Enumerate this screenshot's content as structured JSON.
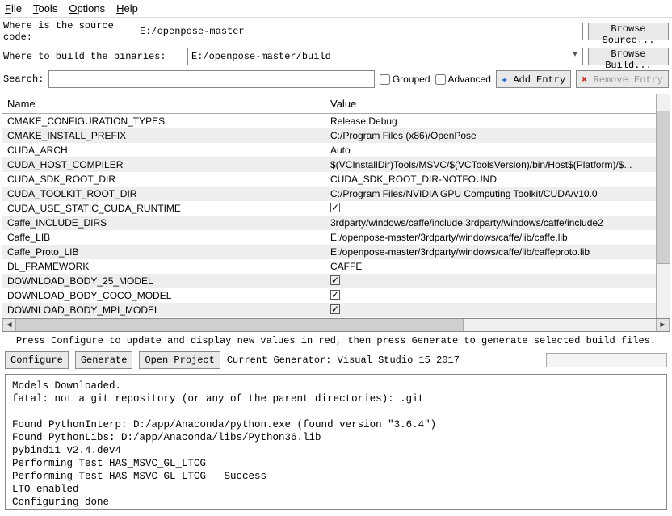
{
  "menu": {
    "file": "File",
    "tools": "Tools",
    "options": "Options",
    "help": "Help"
  },
  "labels": {
    "source": "Where is the source code:",
    "build": "Where to build the binaries:",
    "search": "Search:"
  },
  "paths": {
    "source": "E:/openpose-master",
    "build": "E:/openpose-master/build",
    "search": ""
  },
  "buttons": {
    "browse_source": "Browse Source...",
    "browse_build": "Browse Build...",
    "grouped": "Grouped",
    "advanced": "Advanced",
    "add_entry": "Add Entry",
    "remove_entry": "Remove Entry",
    "configure": "Configure",
    "generate": "Generate",
    "open_project": "Open Project"
  },
  "checks": {
    "grouped": false,
    "advanced": false
  },
  "table": {
    "headers": {
      "name": "Name",
      "value": "Value"
    },
    "rows": [
      {
        "name": "CMAKE_CONFIGURATION_TYPES",
        "value": "Release;Debug",
        "hl": false,
        "type": "text"
      },
      {
        "name": "CMAKE_INSTALL_PREFIX",
        "value": "C:/Program Files (x86)/OpenPose",
        "hl": true,
        "type": "text"
      },
      {
        "name": "CUDA_ARCH",
        "value": "Auto",
        "hl": false,
        "type": "text"
      },
      {
        "name": "CUDA_HOST_COMPILER",
        "value": "$(VCInstallDir)Tools/MSVC/$(VCToolsVersion)/bin/Host$(Platform)/$...",
        "hl": true,
        "type": "text"
      },
      {
        "name": "CUDA_SDK_ROOT_DIR",
        "value": "CUDA_SDK_ROOT_DIR-NOTFOUND",
        "hl": false,
        "type": "text"
      },
      {
        "name": "CUDA_TOOLKIT_ROOT_DIR",
        "value": "C:/Program Files/NVIDIA GPU Computing Toolkit/CUDA/v10.0",
        "hl": true,
        "type": "text"
      },
      {
        "name": "CUDA_USE_STATIC_CUDA_RUNTIME",
        "value": true,
        "hl": false,
        "type": "bool"
      },
      {
        "name": "Caffe_INCLUDE_DIRS",
        "value": "3rdparty/windows/caffe/include;3rdparty/windows/caffe/include2",
        "hl": true,
        "type": "text"
      },
      {
        "name": "Caffe_LIB",
        "value": "E:/openpose-master/3rdparty/windows/caffe/lib/caffe.lib",
        "hl": false,
        "type": "text"
      },
      {
        "name": "Caffe_Proto_LIB",
        "value": "E:/openpose-master/3rdparty/windows/caffe/lib/caffeproto.lib",
        "hl": true,
        "type": "text"
      },
      {
        "name": "DL_FRAMEWORK",
        "value": "CAFFE",
        "hl": false,
        "type": "text"
      },
      {
        "name": "DOWNLOAD_BODY_25_MODEL",
        "value": true,
        "hl": true,
        "type": "bool"
      },
      {
        "name": "DOWNLOAD_BODY_COCO_MODEL",
        "value": true,
        "hl": false,
        "type": "bool"
      },
      {
        "name": "DOWNLOAD_BODY_MPI_MODEL",
        "value": true,
        "hl": true,
        "type": "bool"
      }
    ]
  },
  "hint": "Press Configure to update and display new values in red, then press Generate to generate selected build files.",
  "generator": "Current Generator: Visual Studio 15 2017",
  "console": "Models Downloaded.\nfatal: not a git repository (or any of the parent directories): .git\n\nFound PythonInterp: D:/app/Anaconda/python.exe (found version \"3.6.4\")\nFound PythonLibs: D:/app/Anaconda/libs/Python36.lib\npybind11 v2.4.dev4\nPerforming Test HAS_MSVC_GL_LTCG\nPerforming Test HAS_MSVC_GL_LTCG - Success\nLTO enabled\nConfiguring done\nGenerating done"
}
